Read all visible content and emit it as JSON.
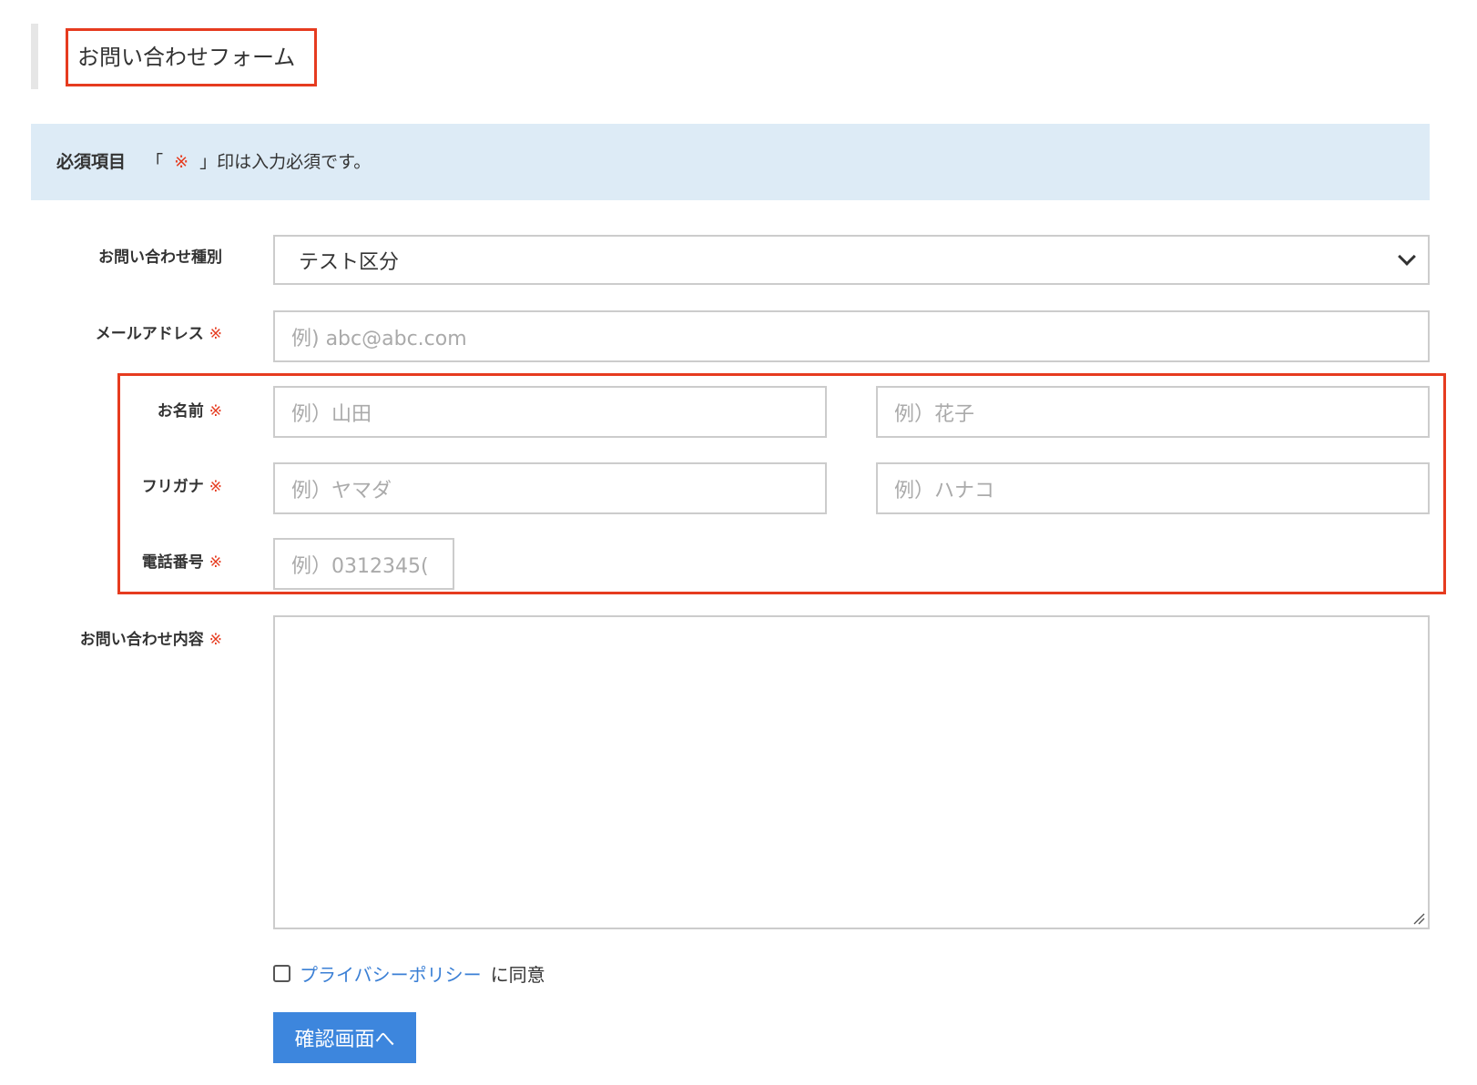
{
  "page": {
    "title": "お問い合わせフォーム"
  },
  "notice": {
    "label": "必須項目",
    "text_before": "「",
    "mark": "※",
    "text_after": "」印は入力必須です。"
  },
  "required_mark": "※",
  "fields": {
    "inquiry_type": {
      "label": "お問い合わせ種別",
      "value": "テスト区分"
    },
    "email": {
      "label": "メールアドレス",
      "placeholder": "例) abc@abc.com"
    },
    "name": {
      "label": "お名前",
      "placeholder_last": "例）山田",
      "placeholder_first": "例）花子"
    },
    "kana": {
      "label": "フリガナ",
      "placeholder_last": "例）ヤマダ",
      "placeholder_first": "例）ハナコ"
    },
    "phone": {
      "label": "電話番号",
      "placeholder": "例）0312345("
    },
    "message": {
      "label": "お問い合わせ内容",
      "value": ""
    }
  },
  "agreement": {
    "link_text": "プライバシーポリシー",
    "suffix": "に同意",
    "checked": false
  },
  "submit": {
    "label": "確認画面へ"
  },
  "colors": {
    "accent": "#3d86dd",
    "required": "#e63b1f",
    "notice_bg": "#ddebf6",
    "link": "#3a7fd5"
  }
}
